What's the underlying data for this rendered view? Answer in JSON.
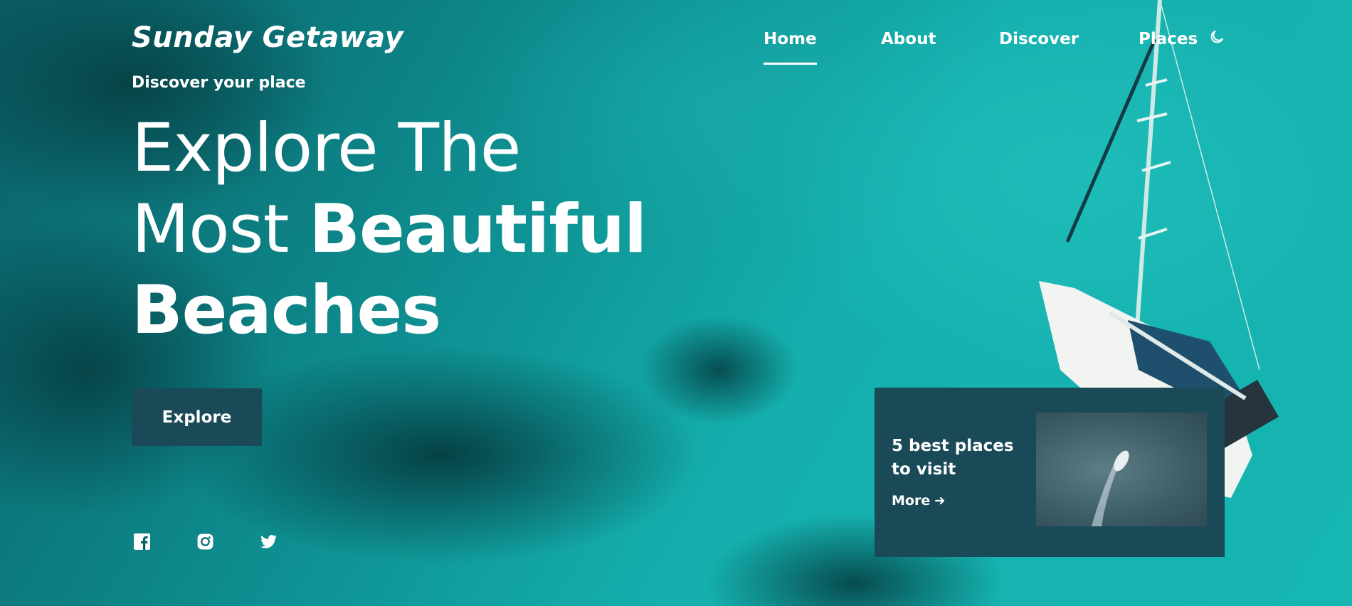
{
  "brand": {
    "logo": "Sunday Getaway",
    "tagline": "Discover your place"
  },
  "nav": {
    "items": [
      {
        "label": "Home",
        "active": true
      },
      {
        "label": "About",
        "active": false
      },
      {
        "label": "Discover",
        "active": false
      },
      {
        "label": "Places",
        "active": false
      }
    ],
    "theme_icon": "moon-icon"
  },
  "hero": {
    "line1": "Explore The",
    "line2_light": "Most ",
    "line2_bold": "Beautiful",
    "line3": "Beaches",
    "cta": "Explore"
  },
  "socials": [
    "facebook-icon",
    "instagram-icon",
    "twitter-icon"
  ],
  "card": {
    "title": "5 best places to visit",
    "more": "More",
    "more_icon": "arrow-right-icon"
  },
  "colors": {
    "accent": "#1a4a57",
    "text": "#ffffff",
    "water": "#0e8e90"
  }
}
